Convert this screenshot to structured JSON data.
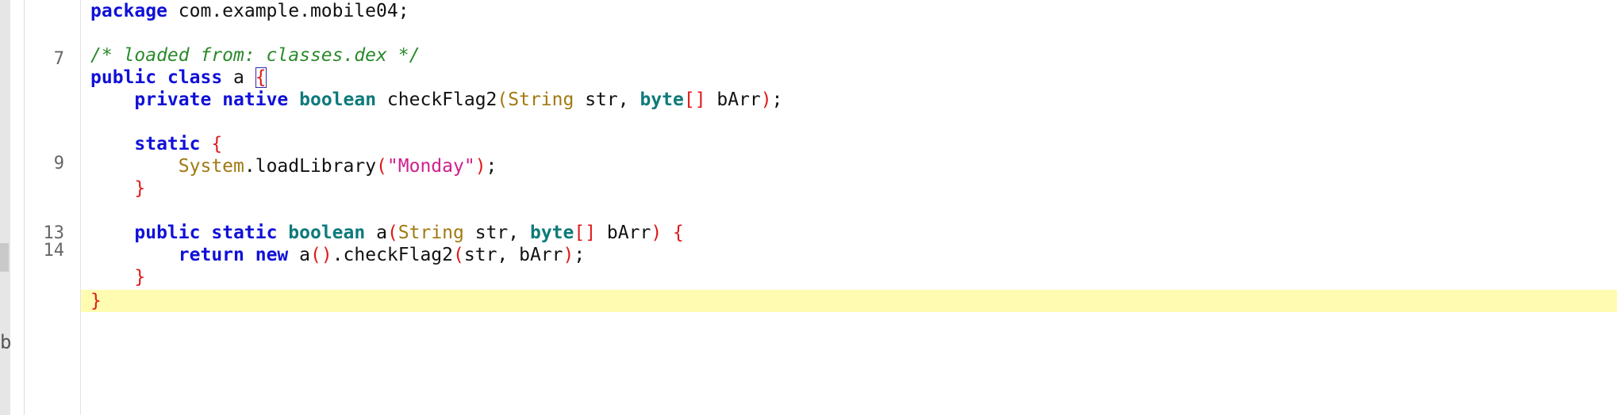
{
  "gutter_line_numbers": [
    "7",
    "9",
    "13",
    "14"
  ],
  "sidebar": {
    "partial_letter": "b"
  },
  "code": {
    "package_kw": "package",
    "package_name": " com.example.mobile04;",
    "comment": "/* loaded from: classes.dex */",
    "class_public": "public",
    "class_kw": "class",
    "class_name": " a ",
    "class_open_brace": "{",
    "m1_private": "private",
    "m1_native": "native",
    "m1_boolean": "boolean",
    "m1_name": " checkFlag2",
    "m1_paren_open": "(",
    "m1_string": "String",
    "m1_str": " str, ",
    "m1_byte": "byte",
    "m1_brackets": "[]",
    "m1_barr": " bArr",
    "m1_paren_close": ")",
    "m1_semi": ";",
    "static_kw": "static",
    "static_open": "{",
    "sys_class": "System",
    "sys_call": ".loadLibrary",
    "sys_paren_open": "(",
    "sys_string": "\"Monday\"",
    "sys_paren_close": ")",
    "sys_semi": ";",
    "static_close": "}",
    "m2_public": "public",
    "m2_static": "static",
    "m2_boolean": "boolean",
    "m2_name": " a",
    "m2_paren_open": "(",
    "m2_string": "String",
    "m2_str": " str, ",
    "m2_byte": "byte",
    "m2_brackets": "[]",
    "m2_barr": " bArr",
    "m2_paren_close": ")",
    "m2_open": "{",
    "ret_kw": "return",
    "new_kw": "new",
    "ret_a": " a",
    "ret_parens": "()",
    "ret_call": ".checkFlag2",
    "ret_paren_open": "(",
    "ret_args": "str, bArr",
    "ret_paren_close": ")",
    "ret_semi": ";",
    "m2_close": "}",
    "class_close": "}"
  },
  "colors": {
    "keyword": "#1010d8",
    "type": "#0e7a7a",
    "class_ref": "#a07a10",
    "comment": "#2a8a2a",
    "string": "#d0208c",
    "brace": "#e01818",
    "line_highlight": "#fffbb0"
  }
}
